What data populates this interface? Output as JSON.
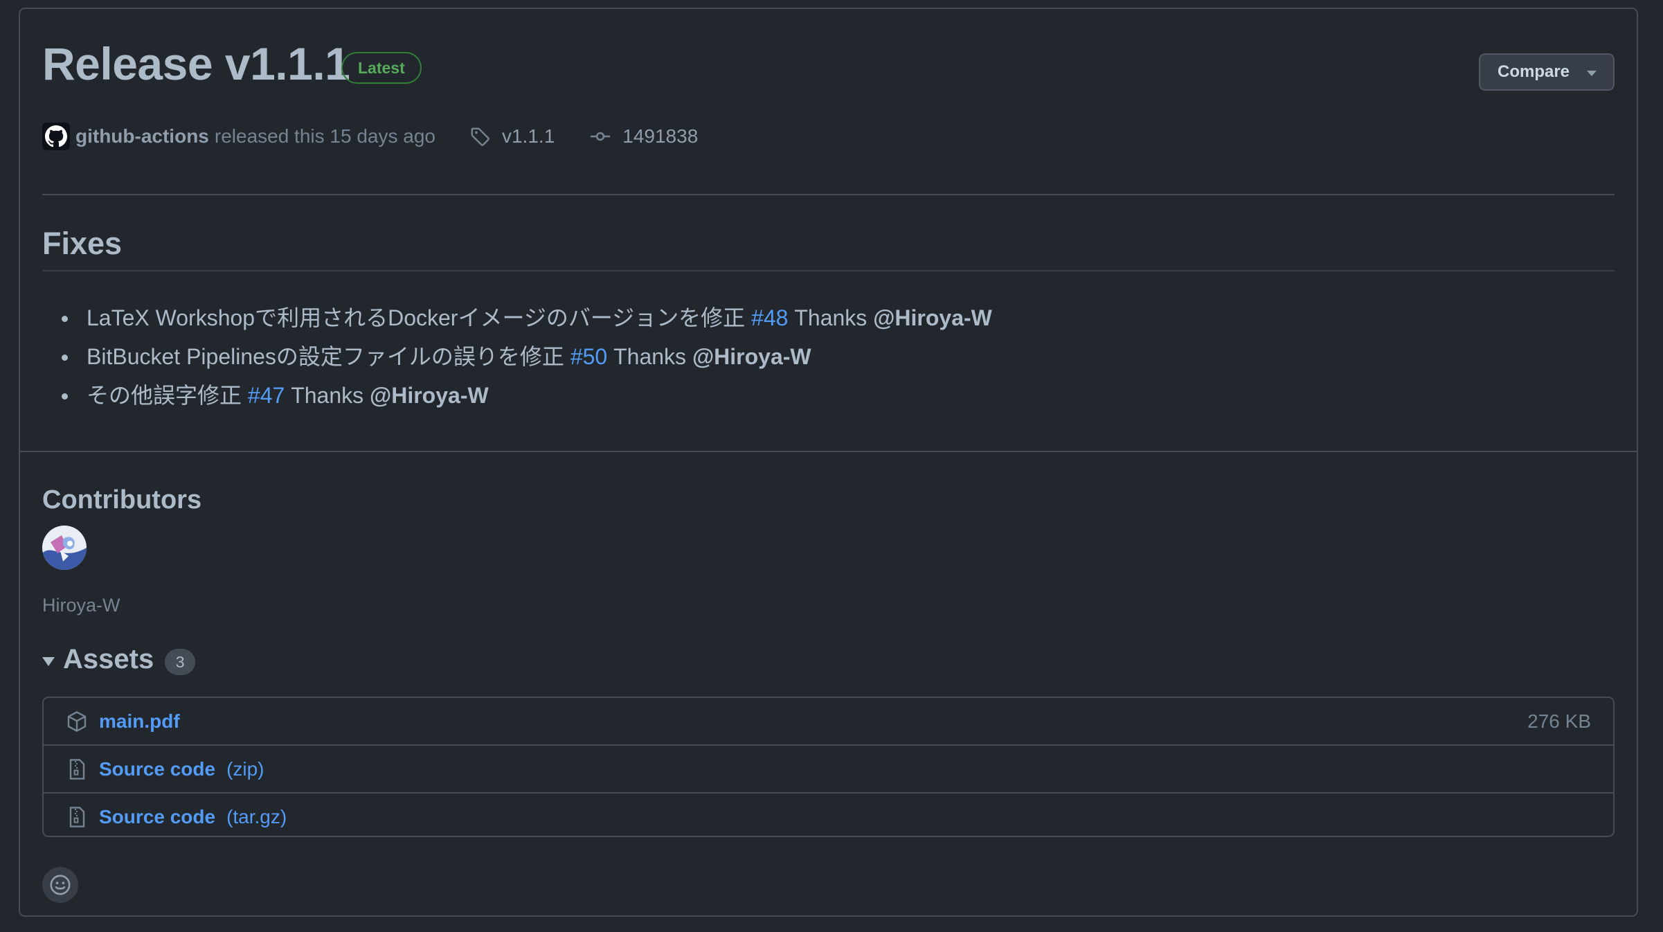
{
  "release": {
    "title": "Release v1.1.1",
    "badge": "Latest",
    "compare_label": "Compare",
    "author": "github-actions",
    "released_text": "released this 15 days ago",
    "tag": "v1.1.1",
    "commit": "1491838"
  },
  "fixes": {
    "heading": "Fixes",
    "items": [
      {
        "text": "LaTeX Workshopで利用されるDockerイメージのバージョンを修正",
        "pr": "#48",
        "thanks": "Thanks",
        "user": "@Hiroya-W"
      },
      {
        "text": "BitBucket Pipelinesの設定ファイルの誤りを修正",
        "pr": "#50",
        "thanks": "Thanks",
        "user": "@Hiroya-W"
      },
      {
        "text": "その他誤字修正",
        "pr": "#47",
        "thanks": "Thanks",
        "user": "@Hiroya-W"
      }
    ]
  },
  "contributors": {
    "heading": "Contributors",
    "names": [
      "Hiroya-W"
    ]
  },
  "assets": {
    "heading": "Assets",
    "count": "3",
    "items": [
      {
        "name": "main.pdf",
        "suffix": "",
        "size": "276 KB",
        "icon": "package-icon"
      },
      {
        "name": "Source code",
        "suffix": "(zip)",
        "size": "",
        "icon": "file-zip-icon"
      },
      {
        "name": "Source code",
        "suffix": "(tar.gz)",
        "size": "",
        "icon": "file-zip-icon"
      }
    ]
  },
  "icons": {
    "tag": "tag-icon",
    "commit": "git-commit-icon",
    "reaction": "smiley-icon"
  },
  "colors": {
    "background": "#22272e",
    "border": "#444c56",
    "text": "#adbac7",
    "muted": "#768390",
    "link": "#539bf5",
    "badge_green": "#57ab5a"
  }
}
